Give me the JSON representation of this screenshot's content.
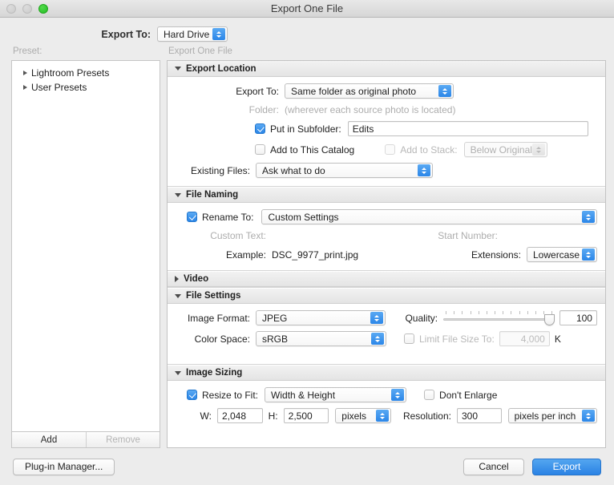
{
  "window": {
    "title": "Export One File",
    "traffic_lights": [
      "close-inactive",
      "minimize-inactive",
      "zoom-active"
    ]
  },
  "topbar": {
    "export_to_label": "Export To:",
    "export_to_value": "Hard Drive"
  },
  "sidebar": {
    "preset_label": "Preset:",
    "items": [
      {
        "label": "Lightroom Presets",
        "expanded": false
      },
      {
        "label": "User Presets",
        "expanded": false
      }
    ],
    "add_label": "Add",
    "remove_label": "Remove",
    "remove_enabled": false
  },
  "right_pane": {
    "title": "Export One File"
  },
  "sections": {
    "export_location": {
      "title": "Export Location",
      "expanded": true,
      "export_to_label": "Export To:",
      "export_to_value": "Same folder as original photo",
      "folder_label": "Folder:",
      "folder_value": "(wherever each source photo is located)",
      "put_in_subfolder_label": "Put in Subfolder:",
      "put_in_subfolder_checked": true,
      "subfolder_value": "Edits",
      "add_to_catalog_label": "Add to This Catalog",
      "add_to_catalog_checked": false,
      "add_to_stack_label": "Add to Stack:",
      "add_to_stack_checked": false,
      "add_to_stack_enabled": false,
      "stack_position_value": "Below Original",
      "existing_files_label": "Existing Files:",
      "existing_files_value": "Ask what to do"
    },
    "file_naming": {
      "title": "File Naming",
      "expanded": true,
      "rename_to_label": "Rename To:",
      "rename_to_checked": true,
      "rename_to_value": "Custom Settings",
      "custom_text_label": "Custom Text:",
      "start_number_label": "Start Number:",
      "example_label": "Example:",
      "example_value": "DSC_9977_print.jpg",
      "extensions_label": "Extensions:",
      "extensions_value": "Lowercase"
    },
    "video": {
      "title": "Video",
      "expanded": false
    },
    "file_settings": {
      "title": "File Settings",
      "expanded": true,
      "image_format_label": "Image Format:",
      "image_format_value": "JPEG",
      "color_space_label": "Color Space:",
      "color_space_value": "sRGB",
      "quality_label": "Quality:",
      "quality_value": "100",
      "quality_percent": 100,
      "limit_file_size_label": "Limit File Size To:",
      "limit_file_size_checked": false,
      "limit_file_size_value": "4,000",
      "limit_file_size_unit": "K"
    },
    "image_sizing": {
      "title": "Image Sizing",
      "expanded": true,
      "resize_to_fit_label": "Resize to Fit:",
      "resize_to_fit_checked": true,
      "resize_to_fit_value": "Width & Height",
      "dont_enlarge_label": "Don't Enlarge",
      "dont_enlarge_checked": false,
      "width_label": "W:",
      "width_value": "2,048",
      "height_label": "H:",
      "height_value": "2,500",
      "units_value": "pixels",
      "resolution_label": "Resolution:",
      "resolution_value": "300",
      "resolution_units_value": "pixels per inch"
    }
  },
  "footer": {
    "plugin_manager_label": "Plug-in Manager...",
    "cancel_label": "Cancel",
    "export_label": "Export"
  },
  "colors": {
    "accent": "#2b86e8",
    "window_bg": "#ececec",
    "panel_bg": "#ffffff",
    "dim_text": "#adadad"
  }
}
